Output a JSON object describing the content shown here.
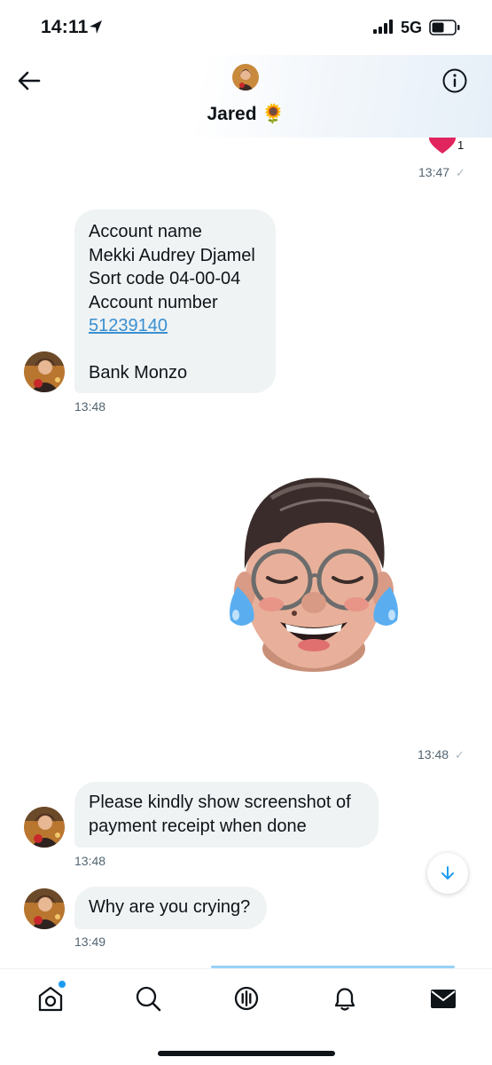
{
  "status_bar": {
    "time": "14:11",
    "network": "5G"
  },
  "header": {
    "name": "Jared 🌻"
  },
  "messages": {
    "reaction_count": "1",
    "sent_1_time": "13:47",
    "account_details": {
      "line1": "Account name",
      "line2": "Mekki Audrey Djamel",
      "line3": "Sort code 04-00-04",
      "line4": "Account number",
      "link": "51239140",
      "line6": "Bank Monzo"
    },
    "received_1_time": "13:48",
    "sent_2_time": "13:48",
    "receipt_text": "Please kindly show screenshot of payment receipt when done",
    "received_2_time": "13:48",
    "cry_text": "Why are you crying?",
    "received_3_time": "13:49",
    "check": "✓"
  },
  "colors": {
    "accent": "#1d9bf0",
    "bubble": "#eff3f4",
    "link": "#3a8fd0",
    "heart": "#e0245e"
  },
  "icons": [
    "back-arrow-icon",
    "info-icon",
    "heart-icon",
    "scroll-down-icon",
    "home-icon",
    "search-icon",
    "spaces-icon",
    "bell-icon",
    "mail-icon"
  ]
}
